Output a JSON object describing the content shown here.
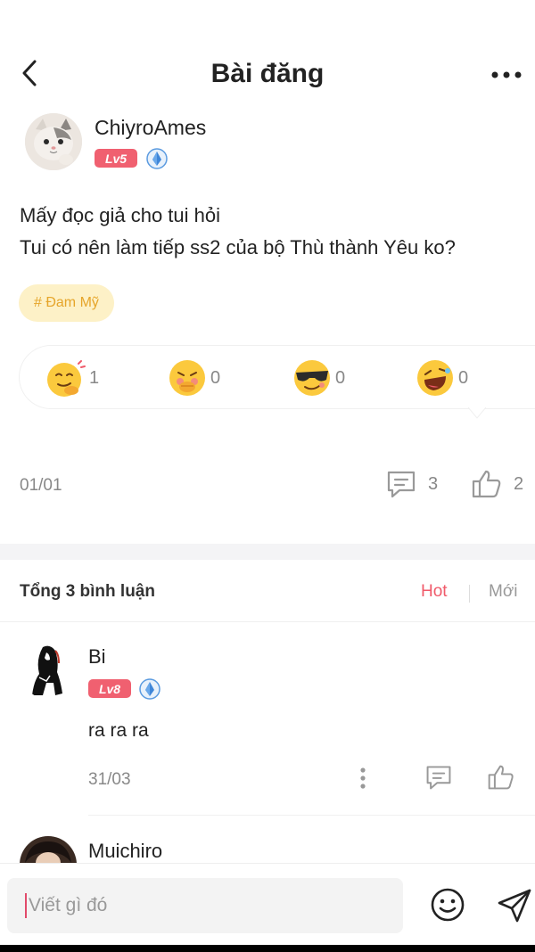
{
  "header": {
    "title": "Bài đăng"
  },
  "post": {
    "author": {
      "name": "ChiyroAmes",
      "level": "Lv5"
    },
    "lines": [
      "Mấy đọc giả cho tui hỏi",
      "Tui có nên làm tiếp ss2 của bộ Thù thành Yêu ko?"
    ],
    "tag": "# Đam Mỹ",
    "reactions": [
      {
        "icon": "thinking-emoji-icon",
        "count": "1"
      },
      {
        "icon": "shy-emoji-icon",
        "count": "0"
      },
      {
        "icon": "cool-emoji-icon",
        "count": "0"
      },
      {
        "icon": "laughing-emoji-icon",
        "count": "0"
      }
    ],
    "date": "01/01",
    "comment_count": "3",
    "like_count": "2"
  },
  "comments_section": {
    "total_label": "Tổng 3 bình luận",
    "sort_hot": "Hot",
    "sort_new": "Mới",
    "items": [
      {
        "name": "Bi",
        "level": "Lv8",
        "text": "ra ra ra",
        "date": "31/03"
      },
      {
        "name": "Muichiro"
      }
    ]
  },
  "composer": {
    "placeholder": "Viết gì đó"
  },
  "colors": {
    "accent": "#f05a6a",
    "level_badge": "#f06070",
    "tag_bg": "#fdf1c7",
    "tag_text": "#e6a52a"
  }
}
